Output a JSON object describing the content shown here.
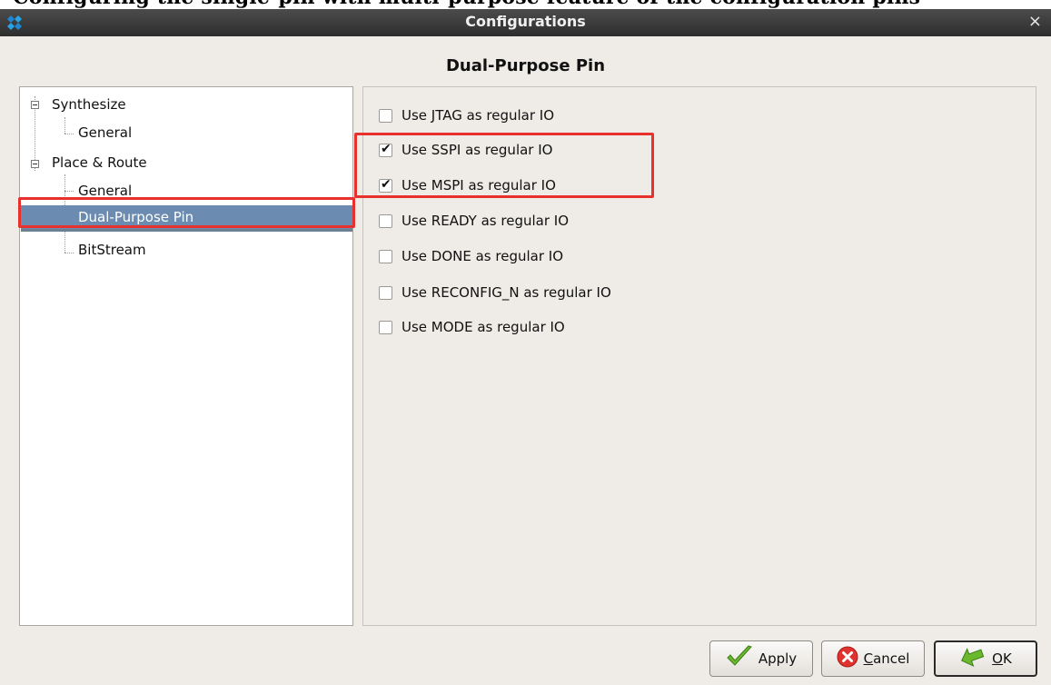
{
  "header_cut_text": "Configuring the single-pin with multi-purpose feature of the configuration pins",
  "window": {
    "title": "Configurations",
    "close_glyph": "×"
  },
  "page_title": "Dual-Purpose Pin",
  "tree": {
    "nodes": [
      {
        "label": "Synthesize",
        "level": 0,
        "expanded": true
      },
      {
        "label": "General",
        "level": 1
      },
      {
        "label": "Place & Route",
        "level": 0,
        "expanded": true
      },
      {
        "label": "General",
        "level": 1
      },
      {
        "label": "Dual-Purpose Pin",
        "level": 1,
        "selected": true
      },
      {
        "label": "BitStream",
        "level": 1
      }
    ]
  },
  "options": [
    {
      "label": "Use JTAG as regular IO",
      "checked": false
    },
    {
      "label": "Use SSPI as regular IO",
      "checked": true
    },
    {
      "label": "Use MSPI as regular IO",
      "checked": true
    },
    {
      "label": "Use READY as regular IO",
      "checked": false
    },
    {
      "label": "Use DONE as regular IO",
      "checked": false
    },
    {
      "label": "Use RECONFIG_N as regular IO",
      "checked": false
    },
    {
      "label": "Use MODE as regular IO",
      "checked": false
    }
  ],
  "buttons": {
    "apply": {
      "label": "Apply",
      "icon": "checkmark-icon"
    },
    "cancel": {
      "label": "ancel",
      "mnemonic": "C",
      "icon": "cancel-icon"
    },
    "ok": {
      "label": "K",
      "mnemonic": "O",
      "icon": "ok-arrow-icon"
    }
  },
  "colors": {
    "titlebar": "#3a3a3a",
    "dialog_bg": "#efebe7",
    "selection": "#6b8cb0",
    "highlight_box": "#e8302c"
  }
}
